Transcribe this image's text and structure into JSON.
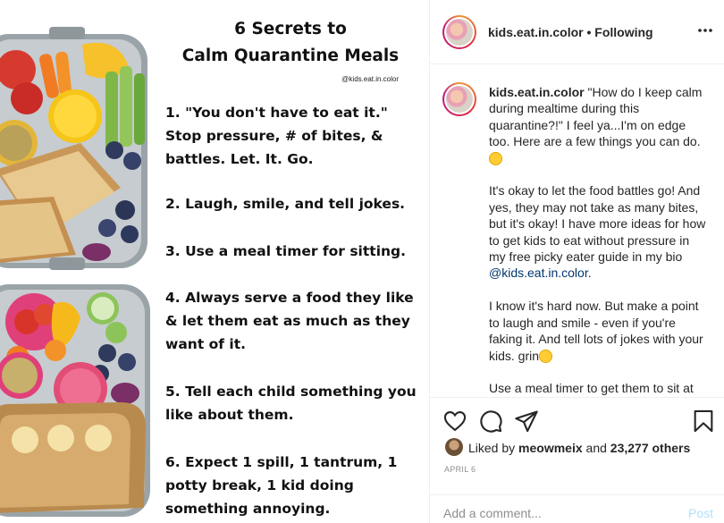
{
  "image": {
    "title_line1": "6 Secrets to",
    "title_line2": "Calm Quarantine Meals",
    "handle": "@kids.eat.in.color",
    "tips": [
      "1. \"You don't have to eat it.\" Stop pressure, # of bites, & battles. Let. It. Go.",
      "2. Laugh, smile, and tell jokes.",
      "3. Use a meal timer for sitting.",
      "4. Always serve a food they like & let them eat as much as they want of it.",
      "5. Tell each child something you like about them.",
      "6. Expect 1 spill, 1 tantrum, 1 potty break, 1 kid doing something annoying."
    ]
  },
  "header": {
    "username": "kids.eat.in.color",
    "separator": " • ",
    "follow_status": "Following",
    "more_icon": "more-horizontal-icon"
  },
  "caption": {
    "username": "kids.eat.in.color",
    "p1": "\"How do I keep calm during mealtime during this quarantine?!\" I feel ya...I'm on edge too. Here are a few things you can do.",
    "p2_a": "It's okay to let the food battles go! And yes, they may not take as many bites, but it's okay! I have more ideas for how to get kids to eat without pressure in my free picky eater guide in my bio ",
    "p2_link": "@kids.eat.in.color",
    "p2_b": ".",
    "p3": "I know it's hard now. But make a point to laugh and smile - even if you're faking it. And tell lots of jokes with your kids. grin",
    "p4": "Use a meal timer to get them to sit at"
  },
  "actions": {
    "like_icon": "heart-icon",
    "comment_icon": "comment-icon",
    "share_icon": "paper-plane-icon",
    "save_icon": "bookmark-icon"
  },
  "likes": {
    "prefix": "Liked by ",
    "liker": "meowmeix",
    "middle": " and ",
    "others": "23,277 others"
  },
  "date": "APRIL 6",
  "comment": {
    "placeholder": "Add a comment...",
    "post_label": "Post"
  }
}
